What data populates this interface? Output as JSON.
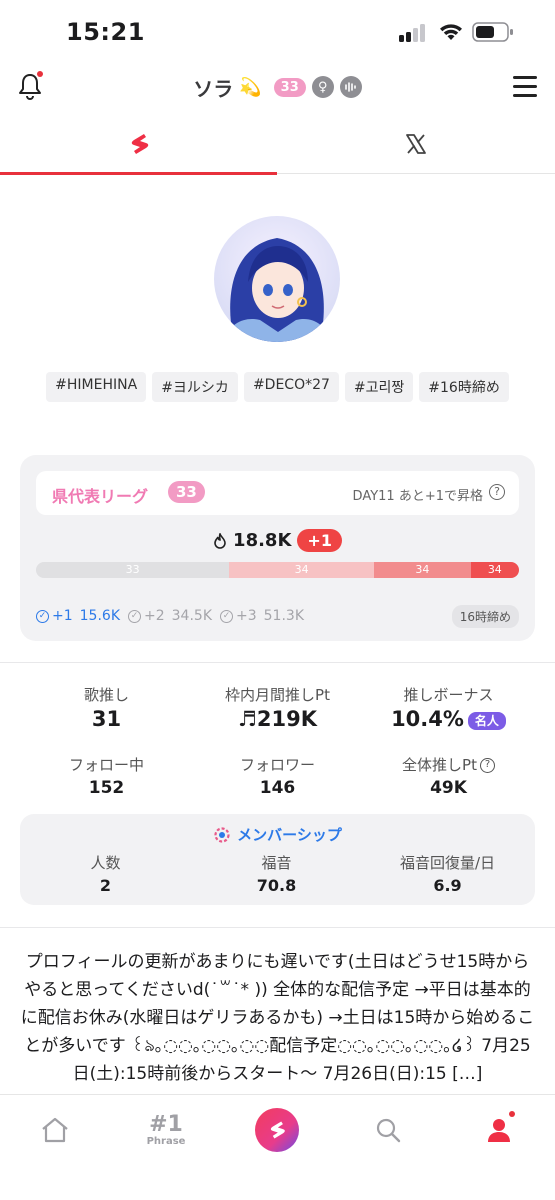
{
  "status_bar": {
    "time": "15:21"
  },
  "header": {
    "name": "ソラ",
    "emoji": "💫",
    "level": "33",
    "gender_icon": "female-icon",
    "voice_icon": "voice-wave-icon"
  },
  "tabs": [
    {
      "icon": "app-logo-icon",
      "active": true
    },
    {
      "icon": "x-logo-icon",
      "active": false
    }
  ],
  "tags": [
    "#HIMEHINA",
    "#ヨルシカ",
    "#DECO*27",
    "#고리짱",
    "#16時締め"
  ],
  "league": {
    "name": "県代表リーグ",
    "rank": "33",
    "day_text": "DAY11 あと+1で昇格",
    "score": "18.8K",
    "rank_change": "+1",
    "bar": [
      {
        "label": "33",
        "fraction": 0.4,
        "color": "#e0e0e2"
      },
      {
        "label": "34",
        "fraction": 0.3,
        "color": "#f7c2c3"
      },
      {
        "label": "34",
        "fraction": 0.2,
        "color": "#f28c8d"
      },
      {
        "label": "34",
        "fraction": 0.1,
        "color": "#ef4f50"
      }
    ],
    "thresholds": [
      {
        "label": "+1",
        "value": "15.6K",
        "color": "#2d7ae8"
      },
      {
        "label": "+2",
        "value": "34.5K",
        "color": "#a5a5aa"
      },
      {
        "label": "+3",
        "value": "51.3K",
        "color": "#a5a5aa"
      }
    ],
    "deadline": "16時締め"
  },
  "stats": {
    "uta_oshi": {
      "label": "歌推し",
      "value": "31"
    },
    "monthly_pt": {
      "label": "枠内月間推しPt",
      "value": "♬219K"
    },
    "bonus": {
      "label": "推しボーナス",
      "value": "10.4%",
      "badge": "名人"
    },
    "following": {
      "label": "フォロー中",
      "value": "152"
    },
    "followers": {
      "label": "フォロワー",
      "value": "146"
    },
    "total_pt": {
      "label": "全体推しPt",
      "value": "49K"
    }
  },
  "membership": {
    "title": "メンバーシップ",
    "members": {
      "label": "人数",
      "value": "2"
    },
    "fukuon": {
      "label": "福音",
      "value": "70.8"
    },
    "recovery": {
      "label": "福音回復量/日",
      "value": "6.9"
    }
  },
  "bio": "プロフィールの更新があまりにも遅いです(土日はどうせ15時からやると思ってくださいd(˙꒳˙* )) 全体的な配信予定 →平日は基本的に配信お休み(水曜日はゲリラあるかも) →土日は15時から始めることが多いです ꒰ঌ｡◌︎◌︎｡◌︎◌︎｡◌︎◌︎配信予定◌︎◌︎｡◌︎◌︎｡◌︎◌︎｡໒꒱ 7月25日(土):15時前後からスタート〜 7月26日(日):15 […]",
  "bottom_nav": {
    "phrase_num": "#1",
    "phrase_label": "Phrase"
  }
}
